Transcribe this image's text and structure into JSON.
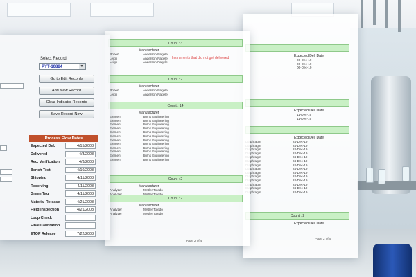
{
  "form": {
    "select_label": "Select Record",
    "selected_record": "PYT-10884",
    "buttons": [
      "Go to Edit Records",
      "Add New Record",
      "Clear Indicator Records",
      "Save Record Now"
    ],
    "process_flow_title": "Process Flow Dates",
    "process_rows": [
      {
        "label": "Expected Del.",
        "value": "4/15/2008"
      },
      {
        "label": "Delivered",
        "value": "4/3/2008"
      },
      {
        "label": "Rec. Verification",
        "value": "4/3/2008"
      },
      {
        "label": "Bench Test",
        "value": "4/10/2008"
      },
      {
        "label": "Shipping",
        "value": "4/11/2008"
      },
      {
        "label": "Receiving",
        "value": "4/11/2008"
      },
      {
        "label": "Green Tag",
        "value": "4/11/2008"
      },
      {
        "label": "Material Release",
        "value": "4/21/2008"
      },
      {
        "label": "Field Inspection",
        "value": "4/21/2008"
      },
      {
        "label": "Loop Check",
        "value": ""
      },
      {
        "label": "Final Calibration",
        "value": ""
      },
      {
        "label": "ETOP Release",
        "value": "7/22/2008"
      }
    ]
  },
  "report_middle": {
    "count_bars": [
      "Count : 3",
      "Count : 2",
      "Count : 14",
      "Count : 2",
      "Count : 2"
    ],
    "column_header": "Manufacturer",
    "groups": [
      {
        "rows": [
          [
            "Robert",
            "Anderson-Nagele"
          ],
          [
            "Leigh",
            "Anderson-Nagele"
          ],
          [
            "Leigh",
            "Anderson-Nagele"
          ]
        ]
      },
      {
        "rows": [
          [
            "Robert",
            "Anderson-Nagele"
          ],
          [
            "Leigh",
            "Anderson-Nagele"
          ]
        ]
      },
      {
        "rows": [
          [
            "Element",
            "Burns Engineering"
          ],
          [
            "Element",
            "Burns Engineering"
          ],
          [
            "Element",
            "Burns Engineering"
          ],
          [
            "Element",
            "Burns Engineering"
          ],
          [
            "Element",
            "Burns Engineering"
          ],
          [
            "Element",
            "Burns Engineering"
          ],
          [
            "Element",
            "Burns Engineering"
          ],
          [
            "Element",
            "Burns Engineering"
          ],
          [
            "Element",
            "Burns Engineering"
          ],
          [
            "Element",
            "Burns Engineering"
          ],
          [
            "Element",
            "Burns Engineering"
          ],
          [
            "Element",
            "Burns Engineering"
          ]
        ]
      },
      {
        "rows": [
          [
            "Analyzer",
            "Mettler Toledo"
          ],
          [
            "Analyzer",
            "Mettler Toledo"
          ]
        ]
      },
      {
        "rows": [
          [
            "Analyzer",
            "Mettler Toledo"
          ],
          [
            "Analyzer",
            "Mettler Toledo"
          ]
        ]
      }
    ],
    "red_note": "Instruments that did not get delivered",
    "footer": "Page 2 of 4"
  },
  "report_right": {
    "group_header": "Expected Del. Date",
    "groups": [
      [
        "06-Dec-19",
        "06-Dec-19",
        "06-Dec-19"
      ],
      [
        "11-Dec-19",
        "11-Dec-19"
      ],
      [
        "24-Dec-19",
        "24-Dec-19",
        "24-Dec-19",
        "24-Dec-19",
        "24-Dec-19",
        "24-Dec-19",
        "24-Dec-19",
        "24-Dec-19",
        "24-Dec-19",
        "24-Dec-19",
        "24-Dec-19",
        "24-Dec-19",
        "24-Dec-19",
        "24-Dec-19"
      ]
    ],
    "left_codes": [
      "Diaphragm",
      "Diaphragm",
      "Diaphragm",
      "Diaphragm",
      "Diaphragm",
      "Diaphragm",
      "Diaphragm",
      "Diaphragm",
      "Diaphragm",
      "Diaphragm",
      "Diaphragm",
      "Diaphragm",
      "Diaphragm",
      "Diaphragm"
    ],
    "count_label": "Count : 2",
    "footer": "Page 2 of 5"
  },
  "colors": {
    "count_bar": "#c9f0c5",
    "section_header": "#c0502c",
    "selected_text": "#1d2fa8",
    "red_note": "#dd4444"
  }
}
